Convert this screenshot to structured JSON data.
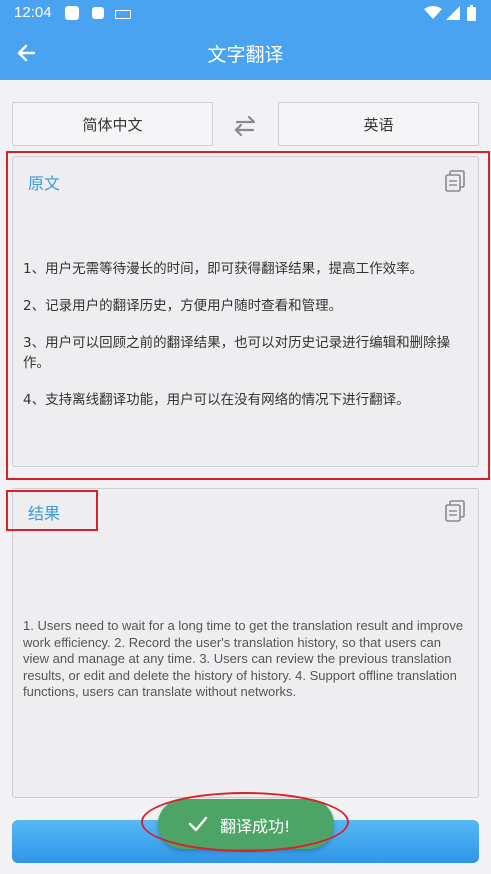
{
  "status_bar": {
    "time": "12:04"
  },
  "app_bar": {
    "title": "文字翻译"
  },
  "languages": {
    "source": "简体中文",
    "target": "英语"
  },
  "source_panel": {
    "label": "原文",
    "lines": [
      "1、用户无需等待漫长的时间，即可获得翻译结果，提高工作效率。",
      "2、记录用户的翻译历史，方便用户随时查看和管理。",
      "3、用户可以回顾之前的翻译结果，也可以对历史记录进行编辑和删除操作。",
      "4、支持离线翻译功能，用户可以在没有网络的情况下进行翻译。"
    ]
  },
  "result_panel": {
    "label": "结果",
    "text": "1. Users need to wait for a long time to get the translation result and improve work efficiency. 2. Record the user's translation history, so that users can view and manage at any time. 3. Users can review the previous translation results, or edit and delete the history of history. 4. Support offline translation functions, users can translate without networks."
  },
  "toast": {
    "text": "翻译成功!"
  },
  "colors": {
    "primary": "#4aa3f0",
    "highlight": "#d8222a",
    "toast": "#4ca466",
    "label": "#3a9ad9"
  }
}
